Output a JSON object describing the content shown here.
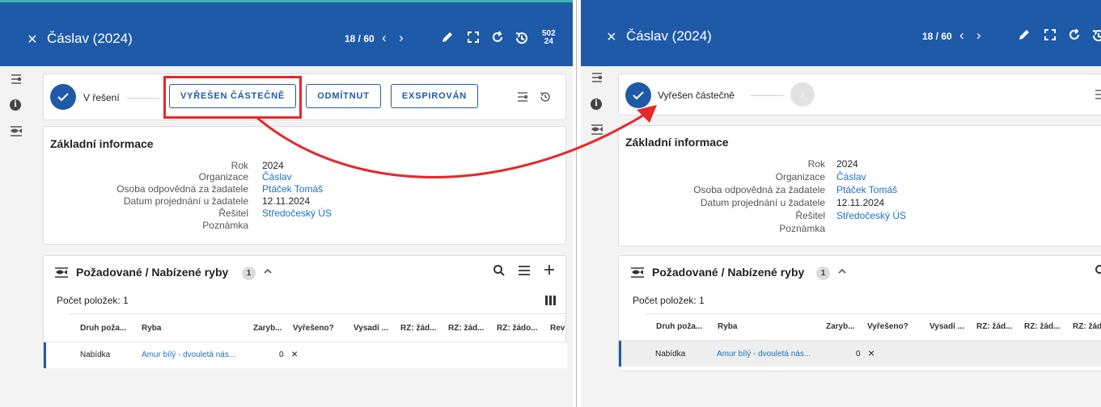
{
  "window": {
    "title": "Čáslav (2024)",
    "pager": "18 / 60",
    "prev": "‹",
    "next": "›",
    "year_badge_top": "502",
    "year_badge_bottom": "24",
    "close_glyph": "×"
  },
  "left": {
    "current_state": "V řešení",
    "actions": [
      "VYŘEŠEN ČÁSTEČNĚ",
      "ODMÍTNUT",
      "EXSPIROVÁN"
    ]
  },
  "right": {
    "current_state": "Vyřešen částečně",
    "next_glyph": "›"
  },
  "info": {
    "title": "Základní informace",
    "fields": [
      {
        "key": "Rok",
        "value": "2024",
        "link": false
      },
      {
        "key": "Organizace",
        "value": "Čáslav",
        "link": true
      },
      {
        "key": "Osoba odpovědná za žadatele",
        "value": "Ptáček Tomáš",
        "link": true
      },
      {
        "key": "Datum projednání u žadatele",
        "value": "12.11.2024",
        "link": false
      },
      {
        "key": "Řešitel",
        "value": "Středočeský ÚS",
        "link": true
      },
      {
        "key": "Poznámka",
        "value": "",
        "link": false
      }
    ]
  },
  "fish": {
    "title": "Požadované / Nabízené ryby",
    "count_badge": "1",
    "count_text": "Počet položek: 1",
    "columns": [
      "Druh poža...",
      "Ryba",
      "Zaryb...",
      "Vyřešeno?",
      "Vysadí ...",
      "RZ: žád...",
      "RZ: žád...",
      "RZ: žádo...",
      "Rev"
    ],
    "rows": [
      {
        "druh": "Nabídka",
        "ryba": "Amur bílý - dvouletá nás...",
        "zaryb": "0",
        "vyreseno": "×"
      }
    ]
  },
  "colors": {
    "header": "#1f5aa9",
    "accent": "#1f5aa9",
    "link": "#1f6fc0",
    "highlight": "#e8262a"
  },
  "icons": [
    "close-icon",
    "pencil-icon",
    "fullscreen-icon",
    "refresh-icon",
    "history-icon",
    "workflow-icon",
    "info-icon",
    "fish-icon",
    "search-icon",
    "list-icon",
    "plus-icon",
    "columns-icon",
    "check-icon",
    "chevron-up-icon"
  ]
}
